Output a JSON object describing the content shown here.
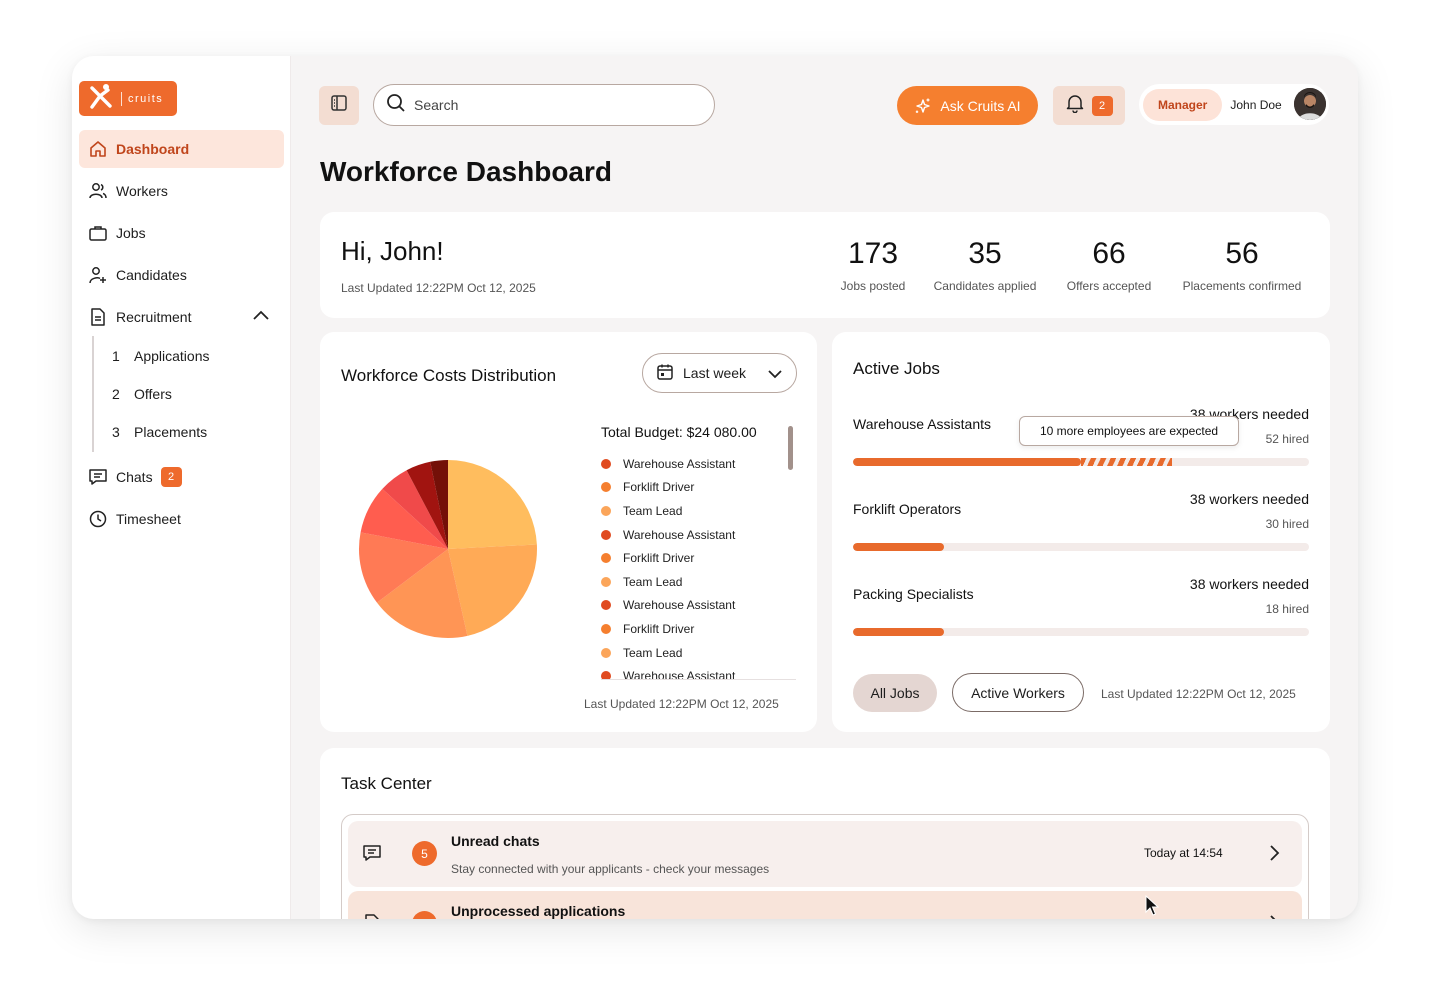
{
  "brand": {
    "word": "cruits",
    "accent": "#ee6a2c"
  },
  "sidebar": {
    "items": [
      {
        "label": "Dashboard",
        "icon": "home-icon"
      },
      {
        "label": "Workers",
        "icon": "users-icon"
      },
      {
        "label": "Jobs",
        "icon": "briefcase-icon"
      },
      {
        "label": "Candidates",
        "icon": "user-plus-icon"
      },
      {
        "label": "Recruitment",
        "icon": "document-icon"
      },
      {
        "label": "Chats",
        "icon": "chat-icon",
        "badge": "2"
      },
      {
        "label": "Timesheet",
        "icon": "clock-icon"
      }
    ],
    "recruitment_sub": [
      {
        "num": "1",
        "label": "Applications"
      },
      {
        "num": "2",
        "label": "Offers"
      },
      {
        "num": "3",
        "label": "Placements"
      }
    ]
  },
  "header": {
    "search_placeholder": "Search",
    "ask_label": "Ask Cruits AI",
    "notifications_count": "2",
    "role": "Manager",
    "user_name": "John Doe"
  },
  "page_title": "Workforce Dashboard",
  "greeting": {
    "title": "Hi, John!",
    "updated": "Last Updated 12:22PM Oct 12, 2025",
    "stats": [
      {
        "value": "173",
        "label": "Jobs posted"
      },
      {
        "value": "35",
        "label": "Candidates applied"
      },
      {
        "value": "66",
        "label": "Offers accepted"
      },
      {
        "value": "56",
        "label": "Placements confirmed"
      }
    ]
  },
  "costs": {
    "title": "Workforce Costs Distribution",
    "period": "Last week",
    "total": "Total Budget: $24 080.00",
    "legend": [
      {
        "label": "Warehouse Assistant",
        "color": "#e04a1f"
      },
      {
        "label": "Forklift Driver",
        "color": "#f57f2f"
      },
      {
        "label": "Team Lead",
        "color": "#fba55a"
      },
      {
        "label": "Warehouse Assistant",
        "color": "#e04a1f"
      },
      {
        "label": "Forklift Driver",
        "color": "#f57f2f"
      },
      {
        "label": "Team Lead",
        "color": "#fba55a"
      },
      {
        "label": "Warehouse Assistant",
        "color": "#e04a1f"
      },
      {
        "label": "Forklift Driver",
        "color": "#f57f2f"
      },
      {
        "label": "Team Lead",
        "color": "#fba55a"
      },
      {
        "label": "Warehouse Assistant",
        "color": "#e04a1f"
      }
    ],
    "updated": "Last Updated 12:22PM Oct 12, 2025",
    "pie_slices": [
      {
        "value": 24.2,
        "color": "#ffbd5e"
      },
      {
        "value": 22.3,
        "color": "#ffaa56"
      },
      {
        "value": 18.2,
        "color": "#ff9555"
      },
      {
        "value": 13.3,
        "color": "#ff7a55"
      },
      {
        "value": 8.8,
        "color": "#ff5d4f"
      },
      {
        "value": 5.5,
        "color": "#f04a4a"
      },
      {
        "value": 4.5,
        "color": "#a11410"
      },
      {
        "value": 3.2,
        "color": "#741008"
      }
    ]
  },
  "active_jobs": {
    "title": "Active Jobs",
    "tooltip": "10 more employees are expected",
    "jobs": [
      {
        "name": "Warehouse Assistants",
        "needed": "38 workers needed",
        "hired": "52 hired",
        "progress": 0.5,
        "expected": 0.2
      },
      {
        "name": "Forklift Operators",
        "needed": "38 workers needed",
        "hired": "30 hired",
        "progress": 0.2
      },
      {
        "name": "Packing Specialists",
        "needed": "38 workers needed",
        "hired": "18 hired",
        "progress": 0.2
      }
    ],
    "tabs": [
      "All Jobs",
      "Active Workers"
    ],
    "updated": "Last Updated 12:22PM Oct 12, 2025"
  },
  "tasks": {
    "title": "Task Center",
    "items": [
      {
        "count": "5",
        "title": "Unread chats",
        "desc": "Stay connected with your applicants - check your messages",
        "time": "Today at 14:54",
        "bg": "#f7efed"
      },
      {
        "count": "",
        "title": "Unprocessed applications",
        "desc": "",
        "time": "",
        "bg": "#f8e4da"
      }
    ]
  }
}
